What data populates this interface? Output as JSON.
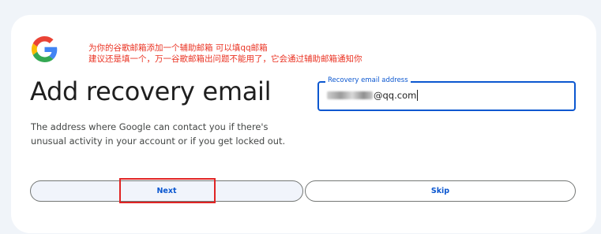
{
  "annotation": {
    "line1": "为你的谷歌邮箱添加一个辅助邮箱 可以填qq邮箱",
    "line2": "建议还是填一个，万一谷歌邮箱出问题不能用了，它会通过辅助邮箱通知你"
  },
  "page": {
    "title": "Add recovery email",
    "description": "The address where Google can contact you if there's unusual activity in your account or if you get locked out."
  },
  "recovery_field": {
    "label": "Recovery email address",
    "value_suffix": "@qq.com"
  },
  "buttons": {
    "next_label": "Next",
    "skip_label": "Skip"
  },
  "colors": {
    "accent": "#0b57d0",
    "annotation": "#ea3323",
    "highlight_box": "#e02424"
  },
  "icons": [
    "google-logo-icon"
  ]
}
